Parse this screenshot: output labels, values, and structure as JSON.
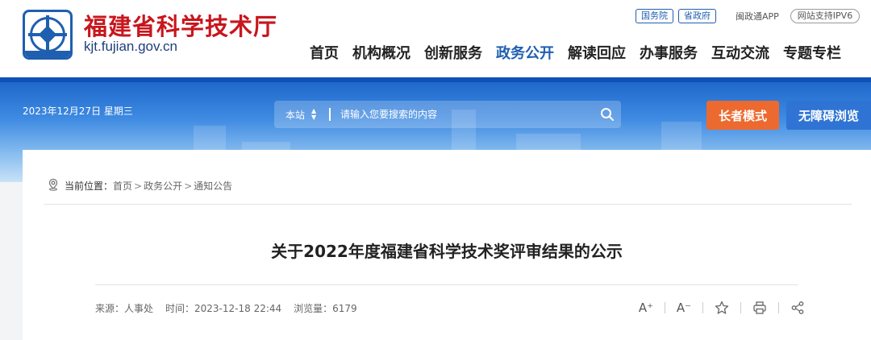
{
  "header": {
    "org_name": "福建省科学技术厅",
    "domain": "kjt.fujian.gov.cn",
    "top_links": [
      "国务院",
      "省政府"
    ],
    "app_link": "闽政通APP",
    "ipv6_badge": "网站支持IPV6"
  },
  "nav": {
    "items": [
      "首页",
      "机构概况",
      "创新服务",
      "政务公开",
      "解读回应",
      "办事服务",
      "互动交流",
      "专题专栏"
    ],
    "active_index": 3
  },
  "banner": {
    "date": "2023年12月27日 星期三",
    "search_scope": "本站",
    "search_placeholder": "请输入您要搜索的内容",
    "elder_mode_label": "长者模式",
    "accessibility_label": "无障碍浏览"
  },
  "breadcrumb": {
    "label": "当前位置：",
    "items": [
      "首页",
      "政务公开",
      "通知公告"
    ],
    "separator": ">"
  },
  "article": {
    "title": "关于2022年度福建省科学技术奖评审结果的公示",
    "source": "来源：人事处",
    "time": "时间：2023-12-18 22:44",
    "views": "浏览量：6179"
  },
  "tools": {
    "font_increase": "A⁺",
    "font_decrease": "A⁻"
  },
  "colors": {
    "brand_red": "#c8161d",
    "brand_blue": "#1f5fb0",
    "elder_orange": "#ec6a2f",
    "access_blue": "#2f74d4"
  }
}
